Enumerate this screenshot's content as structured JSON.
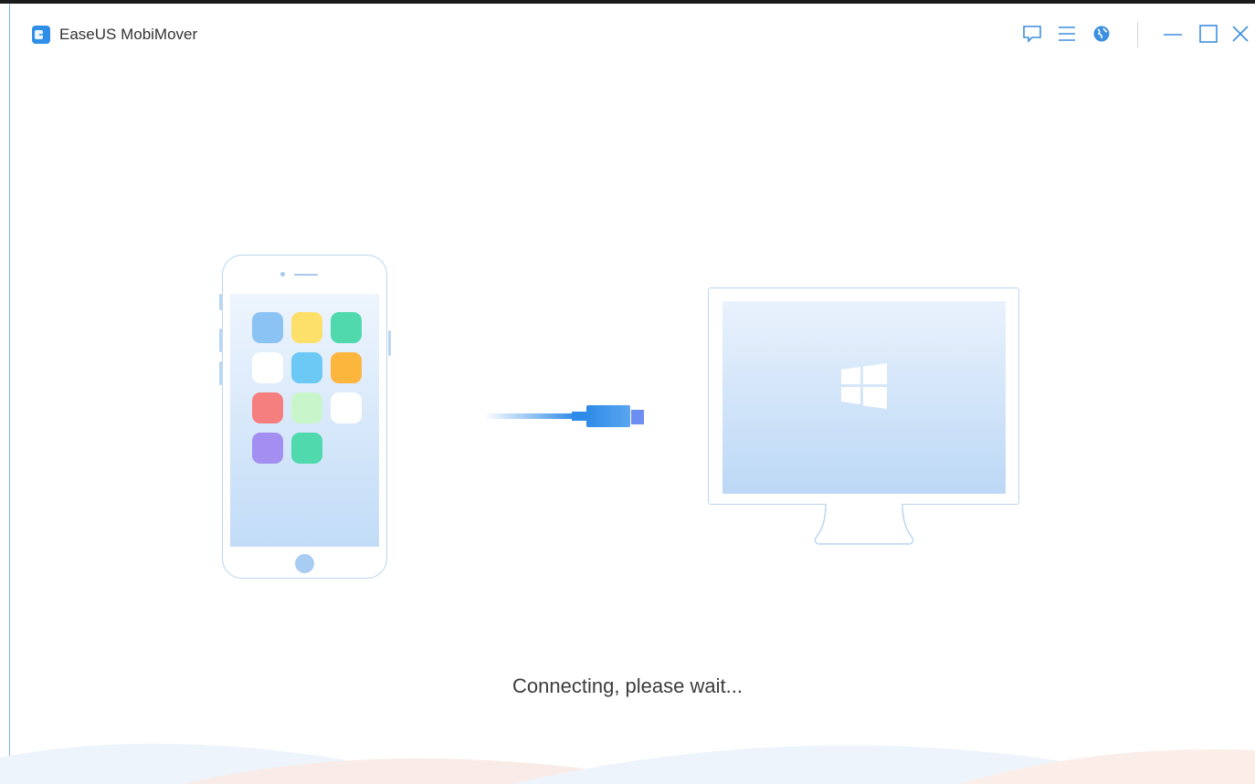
{
  "window": {
    "title": "EaseUS MobiMover",
    "titlebar_buttons": [
      {
        "name": "feedback",
        "icon": "feedback-icon"
      },
      {
        "name": "menu",
        "icon": "menu-icon"
      },
      {
        "name": "language",
        "icon": "globe-icon"
      },
      {
        "name": "minimize",
        "icon": "minimize-icon"
      },
      {
        "name": "maximize",
        "icon": "maximize-icon"
      },
      {
        "name": "close",
        "icon": "close-icon"
      }
    ]
  },
  "illustration": {
    "phone_app_colors": [
      "#8cc3f5",
      "#fde06a",
      "#4fd9ad",
      "#ffffff",
      "#6cc8f5",
      "#fcb53d",
      "#f57f7f",
      "#c8f5c9",
      "#ffffff",
      "#a38ef1",
      "#4fd9ad"
    ],
    "cable_color": "#2e8be8",
    "accent_color": "#2f8fe8"
  },
  "status": {
    "message": "Connecting, please wait..."
  }
}
